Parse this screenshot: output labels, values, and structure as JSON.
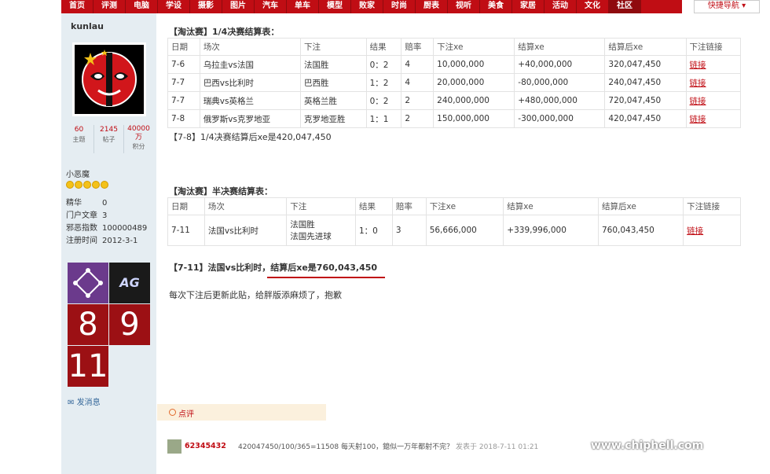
{
  "nav": {
    "items": [
      "首页",
      "评测",
      "电脑",
      "学设",
      "摄影",
      "图片",
      "汽车",
      "单车",
      "模型",
      "败家",
      "时尚",
      "厨表",
      "视听",
      "美食",
      "家居",
      "活动",
      "文化",
      "社区"
    ],
    "active_index": 17,
    "quick_nav": "快捷导航 ▾"
  },
  "sidebar": {
    "username": "kunlau",
    "stats": [
      {
        "value": "60",
        "label": "主题"
      },
      {
        "value": "2145",
        "label": "帖子"
      },
      {
        "value": "40000\n万",
        "label": "积分"
      }
    ],
    "rank": "小恶魔",
    "medal_count": 5,
    "profile": [
      {
        "key": "精华",
        "value": "0"
      },
      {
        "key": "门户文章",
        "value": "3"
      },
      {
        "key": "邪恶指数",
        "value": "100000489"
      },
      {
        "key": "注册时间",
        "value": "2012-3-1"
      }
    ],
    "badges": [
      "",
      "AG",
      "8",
      "9",
      "11"
    ],
    "pm_label": "发消息"
  },
  "quarter": {
    "title": "【淘汰赛】1/4决赛结算表：",
    "headers": [
      "日期",
      "场次",
      "下注",
      "结果",
      "赔率",
      "下注xe",
      "结算xe",
      "结算后xe",
      "下注链接"
    ],
    "rows": [
      [
        "7-6",
        "乌拉圭vs法国",
        "法国胜",
        "0：2",
        "4",
        "10,000,000",
        "+40,000,000",
        "320,047,450",
        "链接"
      ],
      [
        "7-7",
        "巴西vs比利时",
        "巴西胜",
        "1：2",
        "4",
        "20,000,000",
        "-80,000,000",
        "240,047,450",
        "链接"
      ],
      [
        "7-7",
        "瑞典vs英格兰",
        "英格兰胜",
        "0：2",
        "2",
        "240,000,000",
        "+480,000,000",
        "720,047,450",
        "链接"
      ],
      [
        "7-8",
        "俄罗斯vs克罗地亚",
        "克罗地亚胜",
        "1：1",
        "2",
        "150,000,000",
        "-300,000,000",
        "420,047,450",
        "链接"
      ]
    ],
    "summary": "【7-8】1/4决赛结算后xe是420,047,450"
  },
  "semi": {
    "title": "【淘汰赛】半决赛结算表：",
    "headers": [
      "日期",
      "场次",
      "下注",
      "结果",
      "赔率",
      "下注xe",
      "结算xe",
      "结算后xe",
      "下注链接"
    ],
    "row": {
      "date": "7-11",
      "match": "法国vs比利时",
      "bet_line1": "法国胜",
      "bet_line2": "法国先进球",
      "result": "1：0",
      "odds": "3",
      "stake": "56,666,000",
      "settle": "+339,996,000",
      "after": "760,043,450",
      "link": "链接"
    },
    "summary": "【7-11】法国vs比利时，结算后xe是760,043,450"
  },
  "note": "每次下注后更新此贴，给胖版添麻烦了，抱歉",
  "comment": {
    "tab_label": "点评",
    "user": "62345432",
    "text": "420047450/100/365=11508 每天射100，鎴似一万年都射不完？",
    "time": "发表于 2018-7-11 01:21"
  },
  "watermark": {
    "url": "www.chiphell.com",
    "logo_text": "chip hell"
  },
  "colors": {
    "brand_red": "#c00d14",
    "sidebar_bg": "#e5edf2"
  }
}
